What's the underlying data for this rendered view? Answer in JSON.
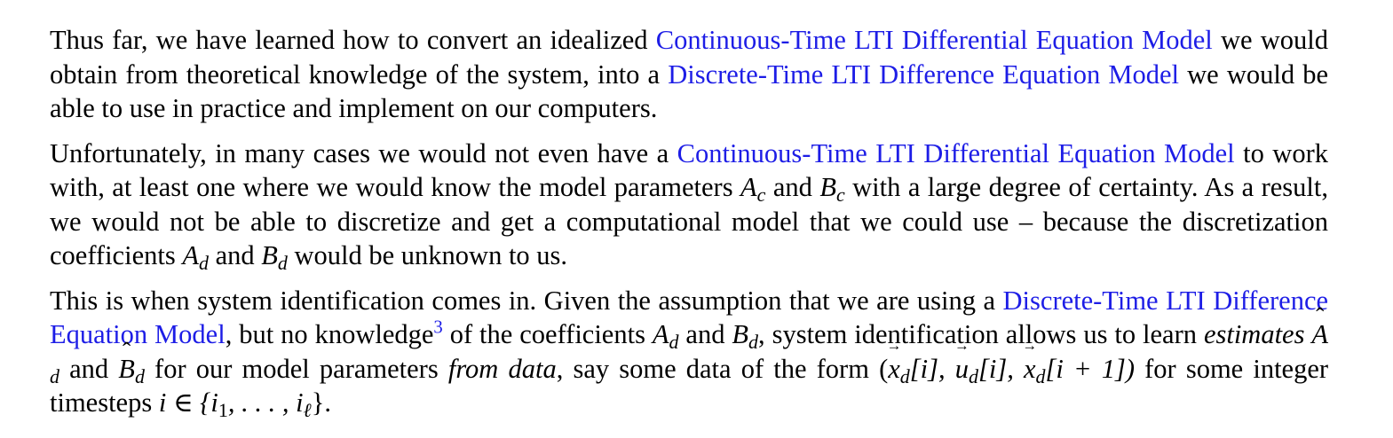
{
  "paragraphs": {
    "p1": {
      "t1": "Thus far, we have learned how to convert an idealized ",
      "link1": "Continuous-Time LTI Differential Equation Model",
      "t2": " we would obtain from theoretical knowledge of the system, into a ",
      "link2": "Discrete-Time LTI Difference Equation Model",
      "t3": " we would be able to use in practice and implement on our computers."
    },
    "p2": {
      "t1": "Unfortunately, in many cases we would not even have a ",
      "link1": "Continuous-Time LTI Differential Equation Model",
      "t2": " to work with, at least one where we would know the model parameters ",
      "A": "A",
      "Asub": "c",
      "and1": " and ",
      "B": "B",
      "Bsub": "c",
      "t3": " with a large degree of certainty. As a result, we would not be able to discretize and get a computational model that we could use – because the discretization coefficients ",
      "Ad": "A",
      "Adsub": "d",
      "and2": " and ",
      "Bd": "B",
      "Bdsub": "d",
      "t4": " would be unknown to us."
    },
    "p3": {
      "t1": "This is when system identification comes in. Given the assumption that we are using a ",
      "link1": "Discrete-Time LTI Difference Equation Model",
      "t2": ", but no knowledge",
      "footnote": "3",
      "t3": " of the coefficients ",
      "Ad": "A",
      "Adsub": "d",
      "and1": " and ",
      "Bd": "B",
      "Bdsub": "d",
      "t4": ", system identification allows us to learn ",
      "em1": "estimates",
      "sp1": " ",
      "hatA": "A",
      "hatAsub": "d",
      "and2": " and ",
      "hatB": "B",
      "hatBsub": "d",
      "t5": " for our model parameters ",
      "em2": "from data",
      "t6": ", say some data of the form ",
      "math1": "(",
      "x1": "x",
      "x1sub": "d",
      "x1idx": "[i], ",
      "u1": "u",
      "u1sub": "d",
      "u1idx": "[i], ",
      "x2": "x",
      "x2sub": "d",
      "x2idx": "[i + 1])",
      "t7": " for some integer timesteps ",
      "set": "i ∈ {i",
      "set1": "1",
      "setmid": ", . . . , i",
      "set2": "ℓ",
      "setend": "}."
    }
  },
  "colors": {
    "link": "#1d1de6",
    "text": "#000000"
  }
}
